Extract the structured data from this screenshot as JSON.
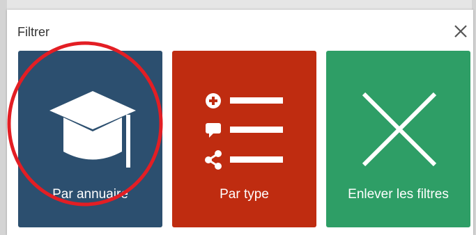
{
  "dialog": {
    "title": "Filtrer",
    "close_icon": "close-icon"
  },
  "tiles": [
    {
      "label": "Par annuaire",
      "color": "#2c4f6f",
      "icon": "graduation-cap-icon"
    },
    {
      "label": "Par type",
      "color": "#bf2c10",
      "icon": "list-icon"
    },
    {
      "label": "Enlever les filtres",
      "color": "#2e9e66",
      "icon": "remove-filters-icon"
    }
  ],
  "highlight_color": "#e31e24"
}
